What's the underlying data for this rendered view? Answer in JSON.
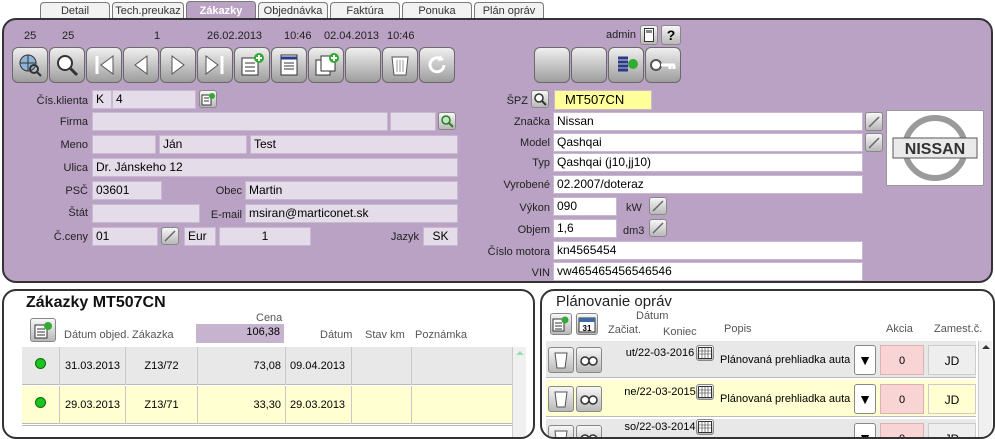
{
  "tabs": [
    "Detail",
    "Tech.preukaz",
    "Zákazky",
    "Objednávka",
    "Faktúra",
    "Ponuka",
    "Plán opráv"
  ],
  "toolbar": {
    "num1": "25",
    "num2": "25",
    "num3": "1",
    "date1": "26.02.2013",
    "time1": "10:46",
    "date2": "02.04.2013",
    "time2": "10:46",
    "user": "admin"
  },
  "customer": {
    "client_no_label": "Čís.klienta",
    "client_prefix": "K",
    "client_no": "4",
    "firm_label": "Firma",
    "firm": "",
    "name_label": "Meno",
    "first_name": "Ján",
    "last_name": "Test",
    "street_label": "Ulica",
    "street": "Dr. Jánskeho 12",
    "zip_label": "PSČ",
    "zip": "03601",
    "city_label": "Obec",
    "city": "Martin",
    "state_label": "Štát",
    "state": "",
    "email_label": "E-mail",
    "email": "msiran@marticonet.sk",
    "price_label": "Č.ceny",
    "price_no": "01",
    "currency": "Eur",
    "rate": "1",
    "lang_label": "Jazyk",
    "lang": "SK"
  },
  "vehicle": {
    "spz_label": "ŠPZ",
    "spz": "MT507CN",
    "brand_label": "Značka",
    "brand": "Nissan",
    "model_label": "Model",
    "model": "Qashqai",
    "type_label": "Typ",
    "type": "Qashqai (j10,jj10)",
    "made_label": "Vyrobené",
    "made": "02.2007/doteraz",
    "power_label": "Výkon",
    "power": "090",
    "power_unit": "kW",
    "volume_label": "Objem",
    "volume": "1,6",
    "volume_unit": "dm3",
    "engine_label": "Číslo motora",
    "engine": "kn4565454",
    "vin_label": "VIN",
    "vin": "vw465465456546546",
    "logo_text": "NISSAN"
  },
  "orders": {
    "title": "Zákazky MT507CN",
    "col_cena": "Cena",
    "col_date_order": "Dátum objed.",
    "col_order": "Zákazka",
    "total": "106,38",
    "col_date": "Dátum",
    "col_km": "Stav km",
    "col_note": "Poznámka",
    "rows": [
      {
        "date_order": "31.03.2013",
        "order": "Z13/72",
        "price": "73,08",
        "date": "09.04.2013"
      },
      {
        "date_order": "29.03.2013",
        "order": "Z13/71",
        "price": "33,30",
        "date": "29.03.2013"
      }
    ]
  },
  "plan": {
    "title": "Plánovanie opráv",
    "col_date": "Dátum",
    "col_start": "Začiat.",
    "col_end": "Koniec",
    "col_desc": "Popis",
    "col_action": "Akcia",
    "col_employee": "Zamest.č.",
    "rows": [
      {
        "date": "ut/22-03-2016",
        "desc": "Plánovaná prehliadka auta",
        "action": "0",
        "employee": "JD"
      },
      {
        "date": "ne/22-03-2015",
        "desc": "Plánovaná prehliadka auta",
        "action": "0",
        "employee": "JD"
      },
      {
        "date": "so/22-03-2014",
        "desc": "",
        "action": "0",
        "employee": "JD"
      }
    ]
  }
}
